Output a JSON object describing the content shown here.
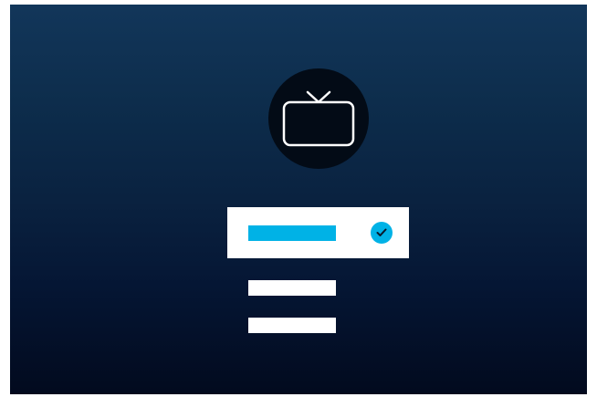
{
  "icons": {
    "hero": "tv-icon",
    "selected_indicator": "check-icon"
  },
  "options": {
    "selected_index": 0,
    "count": 3
  },
  "colors": {
    "background_top": "#12365a",
    "background_bottom": "#020a1e",
    "badge": "#030b16",
    "accent": "#00b2e6",
    "option": "#ffffff"
  }
}
